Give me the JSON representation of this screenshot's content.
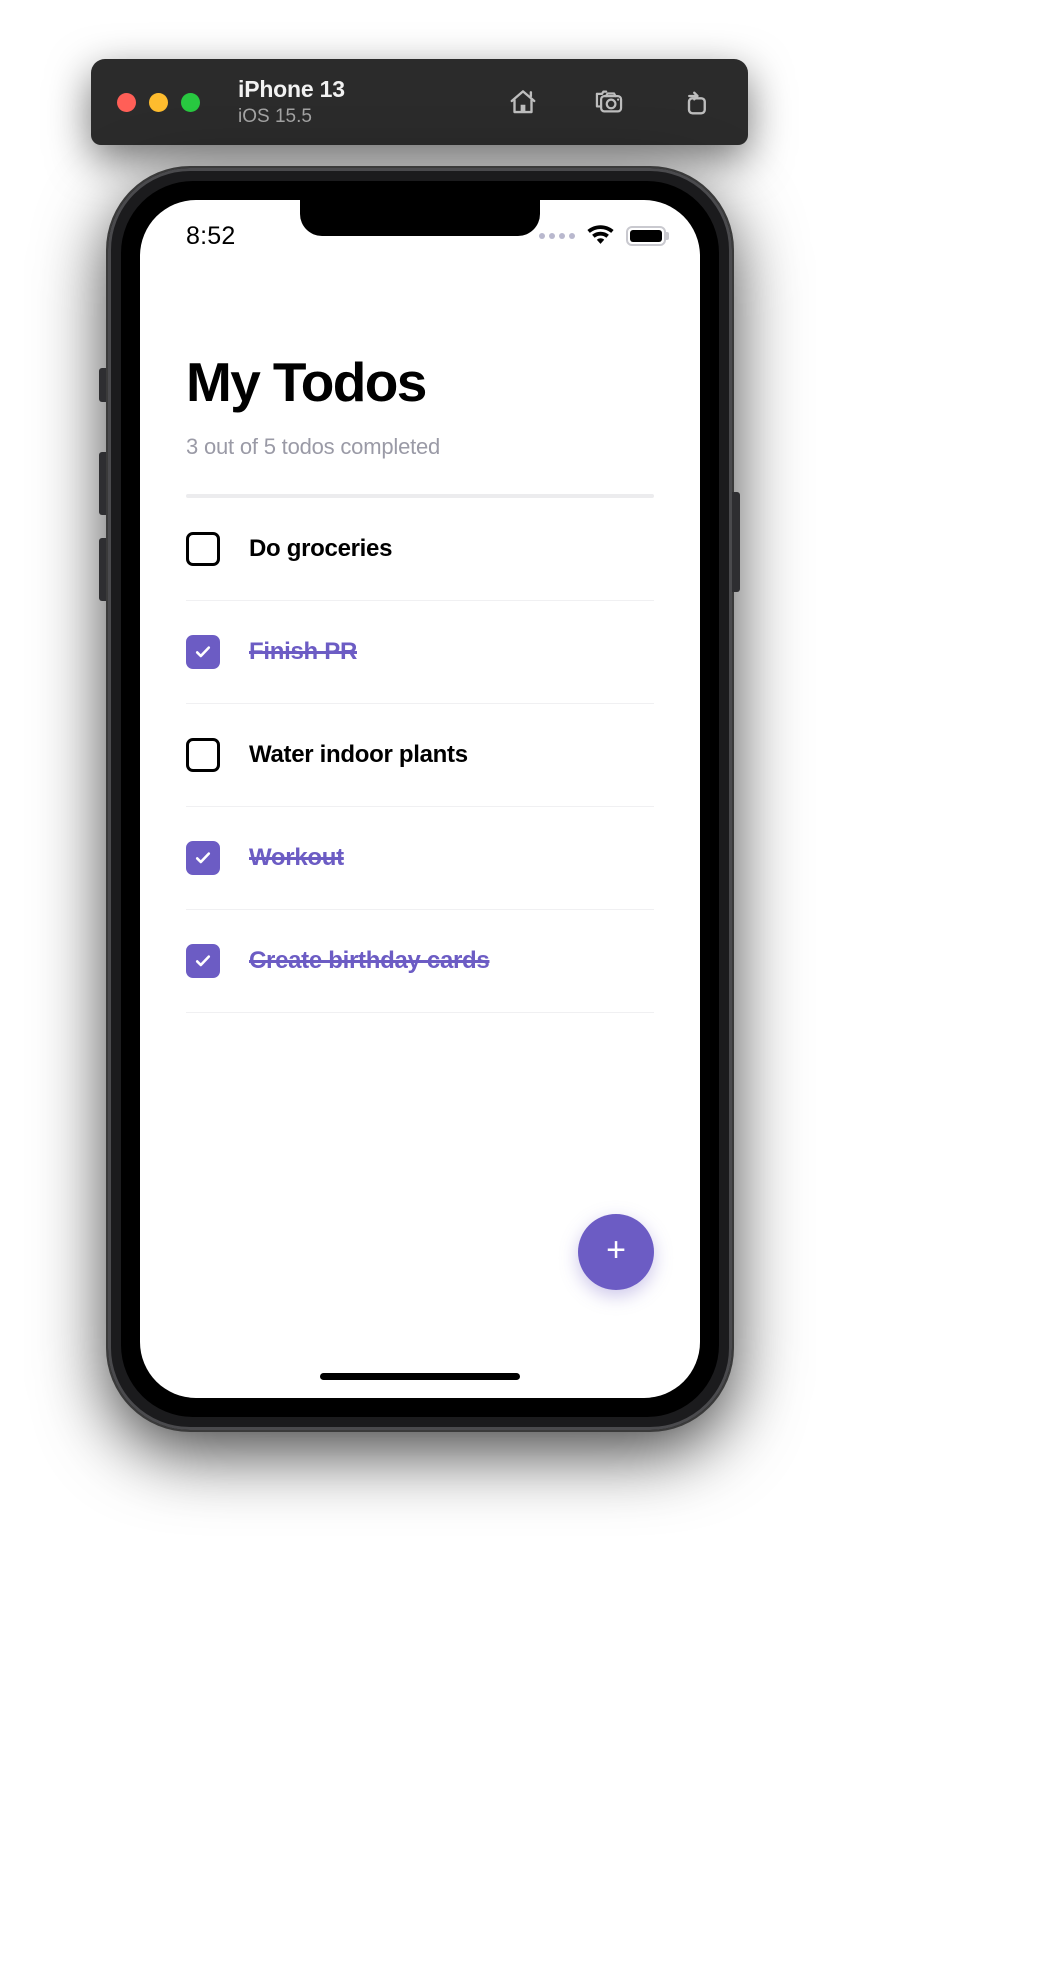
{
  "simulator": {
    "device": "iPhone 13",
    "os": "iOS 15.5",
    "window_controls": [
      "close",
      "minimize",
      "zoom"
    ],
    "actions": [
      {
        "name": "home-icon",
        "label": "Home"
      },
      {
        "name": "screenshot-icon",
        "label": "Screenshot"
      },
      {
        "name": "rotate-icon",
        "label": "Rotate"
      }
    ],
    "titlebar_bg": "#2b2b2b"
  },
  "status_bar": {
    "time": "8:52",
    "signal_dots": 4,
    "wifi": "wifi-icon",
    "battery_full": true
  },
  "app": {
    "title": "My Todos",
    "subtitle": "3 out of 5 todos completed",
    "accent_color": "#6c5cc4",
    "completed_count": 3,
    "total_count": 5,
    "todos": [
      {
        "label": "Do groceries",
        "done": false
      },
      {
        "label": "Finish PR",
        "done": true
      },
      {
        "label": "Water indoor plants",
        "done": false
      },
      {
        "label": "Workout",
        "done": true
      },
      {
        "label": "Create birthday cards",
        "done": true
      }
    ],
    "add_button_label": "+"
  }
}
